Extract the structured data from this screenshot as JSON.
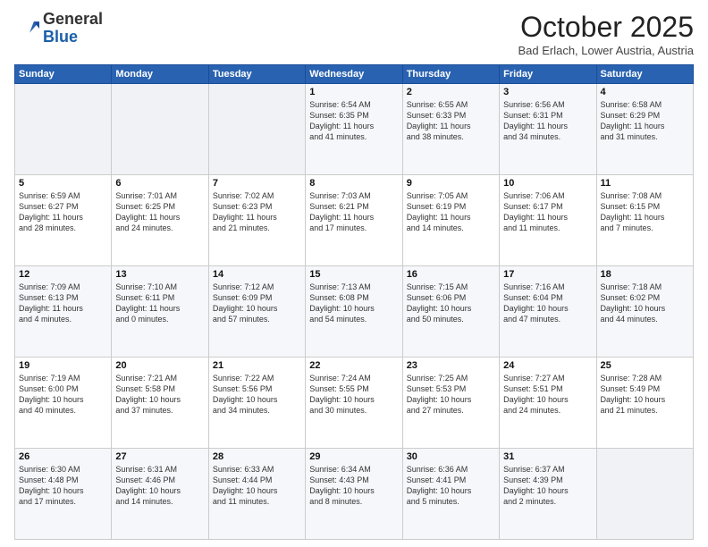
{
  "header": {
    "logo_general": "General",
    "logo_blue": "Blue",
    "month_title": "October 2025",
    "location": "Bad Erlach, Lower Austria, Austria"
  },
  "days_of_week": [
    "Sunday",
    "Monday",
    "Tuesday",
    "Wednesday",
    "Thursday",
    "Friday",
    "Saturday"
  ],
  "weeks": [
    [
      {
        "day": "",
        "content": ""
      },
      {
        "day": "",
        "content": ""
      },
      {
        "day": "",
        "content": ""
      },
      {
        "day": "1",
        "content": "Sunrise: 6:54 AM\nSunset: 6:35 PM\nDaylight: 11 hours\nand 41 minutes."
      },
      {
        "day": "2",
        "content": "Sunrise: 6:55 AM\nSunset: 6:33 PM\nDaylight: 11 hours\nand 38 minutes."
      },
      {
        "day": "3",
        "content": "Sunrise: 6:56 AM\nSunset: 6:31 PM\nDaylight: 11 hours\nand 34 minutes."
      },
      {
        "day": "4",
        "content": "Sunrise: 6:58 AM\nSunset: 6:29 PM\nDaylight: 11 hours\nand 31 minutes."
      }
    ],
    [
      {
        "day": "5",
        "content": "Sunrise: 6:59 AM\nSunset: 6:27 PM\nDaylight: 11 hours\nand 28 minutes."
      },
      {
        "day": "6",
        "content": "Sunrise: 7:01 AM\nSunset: 6:25 PM\nDaylight: 11 hours\nand 24 minutes."
      },
      {
        "day": "7",
        "content": "Sunrise: 7:02 AM\nSunset: 6:23 PM\nDaylight: 11 hours\nand 21 minutes."
      },
      {
        "day": "8",
        "content": "Sunrise: 7:03 AM\nSunset: 6:21 PM\nDaylight: 11 hours\nand 17 minutes."
      },
      {
        "day": "9",
        "content": "Sunrise: 7:05 AM\nSunset: 6:19 PM\nDaylight: 11 hours\nand 14 minutes."
      },
      {
        "day": "10",
        "content": "Sunrise: 7:06 AM\nSunset: 6:17 PM\nDaylight: 11 hours\nand 11 minutes."
      },
      {
        "day": "11",
        "content": "Sunrise: 7:08 AM\nSunset: 6:15 PM\nDaylight: 11 hours\nand 7 minutes."
      }
    ],
    [
      {
        "day": "12",
        "content": "Sunrise: 7:09 AM\nSunset: 6:13 PM\nDaylight: 11 hours\nand 4 minutes."
      },
      {
        "day": "13",
        "content": "Sunrise: 7:10 AM\nSunset: 6:11 PM\nDaylight: 11 hours\nand 0 minutes."
      },
      {
        "day": "14",
        "content": "Sunrise: 7:12 AM\nSunset: 6:09 PM\nDaylight: 10 hours\nand 57 minutes."
      },
      {
        "day": "15",
        "content": "Sunrise: 7:13 AM\nSunset: 6:08 PM\nDaylight: 10 hours\nand 54 minutes."
      },
      {
        "day": "16",
        "content": "Sunrise: 7:15 AM\nSunset: 6:06 PM\nDaylight: 10 hours\nand 50 minutes."
      },
      {
        "day": "17",
        "content": "Sunrise: 7:16 AM\nSunset: 6:04 PM\nDaylight: 10 hours\nand 47 minutes."
      },
      {
        "day": "18",
        "content": "Sunrise: 7:18 AM\nSunset: 6:02 PM\nDaylight: 10 hours\nand 44 minutes."
      }
    ],
    [
      {
        "day": "19",
        "content": "Sunrise: 7:19 AM\nSunset: 6:00 PM\nDaylight: 10 hours\nand 40 minutes."
      },
      {
        "day": "20",
        "content": "Sunrise: 7:21 AM\nSunset: 5:58 PM\nDaylight: 10 hours\nand 37 minutes."
      },
      {
        "day": "21",
        "content": "Sunrise: 7:22 AM\nSunset: 5:56 PM\nDaylight: 10 hours\nand 34 minutes."
      },
      {
        "day": "22",
        "content": "Sunrise: 7:24 AM\nSunset: 5:55 PM\nDaylight: 10 hours\nand 30 minutes."
      },
      {
        "day": "23",
        "content": "Sunrise: 7:25 AM\nSunset: 5:53 PM\nDaylight: 10 hours\nand 27 minutes."
      },
      {
        "day": "24",
        "content": "Sunrise: 7:27 AM\nSunset: 5:51 PM\nDaylight: 10 hours\nand 24 minutes."
      },
      {
        "day": "25",
        "content": "Sunrise: 7:28 AM\nSunset: 5:49 PM\nDaylight: 10 hours\nand 21 minutes."
      }
    ],
    [
      {
        "day": "26",
        "content": "Sunrise: 6:30 AM\nSunset: 4:48 PM\nDaylight: 10 hours\nand 17 minutes."
      },
      {
        "day": "27",
        "content": "Sunrise: 6:31 AM\nSunset: 4:46 PM\nDaylight: 10 hours\nand 14 minutes."
      },
      {
        "day": "28",
        "content": "Sunrise: 6:33 AM\nSunset: 4:44 PM\nDaylight: 10 hours\nand 11 minutes."
      },
      {
        "day": "29",
        "content": "Sunrise: 6:34 AM\nSunset: 4:43 PM\nDaylight: 10 hours\nand 8 minutes."
      },
      {
        "day": "30",
        "content": "Sunrise: 6:36 AM\nSunset: 4:41 PM\nDaylight: 10 hours\nand 5 minutes."
      },
      {
        "day": "31",
        "content": "Sunrise: 6:37 AM\nSunset: 4:39 PM\nDaylight: 10 hours\nand 2 minutes."
      },
      {
        "day": "",
        "content": ""
      }
    ]
  ]
}
